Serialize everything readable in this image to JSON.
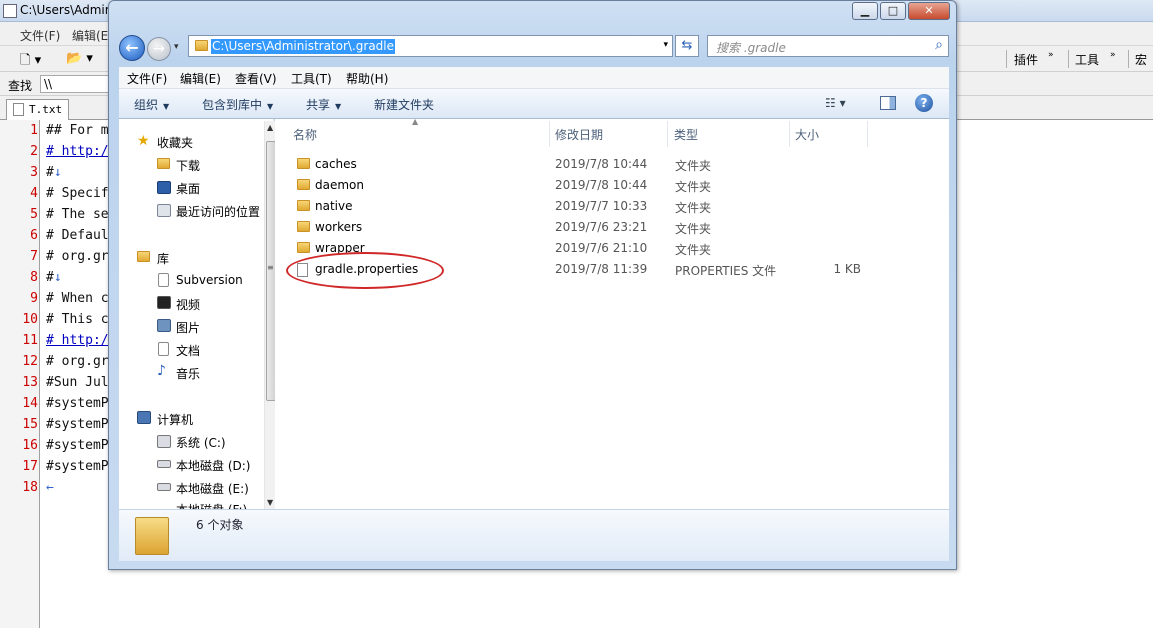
{
  "bg_app": {
    "title": "C:\\Users\\Admir",
    "menu": [
      "文件(F)",
      "编辑(E"
    ],
    "toolbar_right": [
      "插件",
      "工具",
      "宏"
    ],
    "find_label": "查找",
    "find_value": "\\\\",
    "tabs": [
      "T.txt"
    ]
  },
  "editor": {
    "line_numbers": [
      "1",
      "2",
      "3",
      "4",
      "5",
      "6",
      "7",
      "8",
      "9",
      "10",
      "11",
      "12",
      "13",
      "14",
      "15",
      "16",
      "17",
      "18"
    ],
    "lines": [
      {
        "text": "## For m",
        "link": false
      },
      {
        "text": "# http:/",
        "link": true
      },
      {
        "text": "#",
        "arrow": "↓"
      },
      {
        "text": "# Specif",
        "link": false
      },
      {
        "text": "# The se",
        "link": false
      },
      {
        "text": "# Defaul",
        "link": false
      },
      {
        "text": "# org.gr",
        "link": false
      },
      {
        "text": "#",
        "arrow": "↓"
      },
      {
        "text": "# When c",
        "link": false
      },
      {
        "text": "# This c",
        "link": false
      },
      {
        "text": "# http:/",
        "link": true
      },
      {
        "text": "# org.gr",
        "link": false
      },
      {
        "text": "#Sun Jul",
        "link": false
      },
      {
        "text": "#systemP",
        "link": false
      },
      {
        "text": "#systemP",
        "link": false
      },
      {
        "text": "#systemP",
        "link": false
      },
      {
        "text": "#systemP",
        "link": false
      },
      {
        "text": "",
        "arrow": "←"
      }
    ]
  },
  "explorer": {
    "address": "C:\\Users\\Administrator\\.gradle",
    "search_placeholder": "搜索 .gradle",
    "menu": [
      "文件(F)",
      "编辑(E)",
      "查看(V)",
      "工具(T)",
      "帮助(H)"
    ],
    "commands": {
      "organize": "组织",
      "include_library": "包含到库中",
      "share": "共享",
      "new_folder": "新建文件夹"
    },
    "nav": {
      "favorites": "收藏夹",
      "fav_items": [
        "下载",
        "桌面",
        "最近访问的位置"
      ],
      "library": "库",
      "lib_items": [
        "Subversion",
        "视频",
        "图片",
        "文档",
        "音乐"
      ],
      "computer": "计算机",
      "comp_items": [
        "系统 (C:)",
        "本地磁盘 (D:)",
        "本地磁盘 (E:)",
        "本地磁盘 (F:)"
      ]
    },
    "columns": [
      "名称",
      "修改日期",
      "类型",
      "大小"
    ],
    "files": [
      {
        "name": "caches",
        "date": "2019/7/8 10:44",
        "type": "文件夹",
        "size": "",
        "kind": "folder"
      },
      {
        "name": "daemon",
        "date": "2019/7/8 10:44",
        "type": "文件夹",
        "size": "",
        "kind": "folder"
      },
      {
        "name": "native",
        "date": "2019/7/7 10:33",
        "type": "文件夹",
        "size": "",
        "kind": "folder"
      },
      {
        "name": "workers",
        "date": "2019/7/6 23:21",
        "type": "文件夹",
        "size": "",
        "kind": "folder"
      },
      {
        "name": "wrapper",
        "date": "2019/7/6 21:10",
        "type": "文件夹",
        "size": "",
        "kind": "folder"
      },
      {
        "name": "gradle.properties",
        "date": "2019/7/8 11:39",
        "type": "PROPERTIES 文件",
        "size": "1 KB",
        "kind": "file"
      }
    ],
    "status": "6 个对象"
  },
  "colors": {
    "highlight_circle": "#d02828",
    "address_selection": "#3399ff",
    "line_number": "#cc0000"
  }
}
